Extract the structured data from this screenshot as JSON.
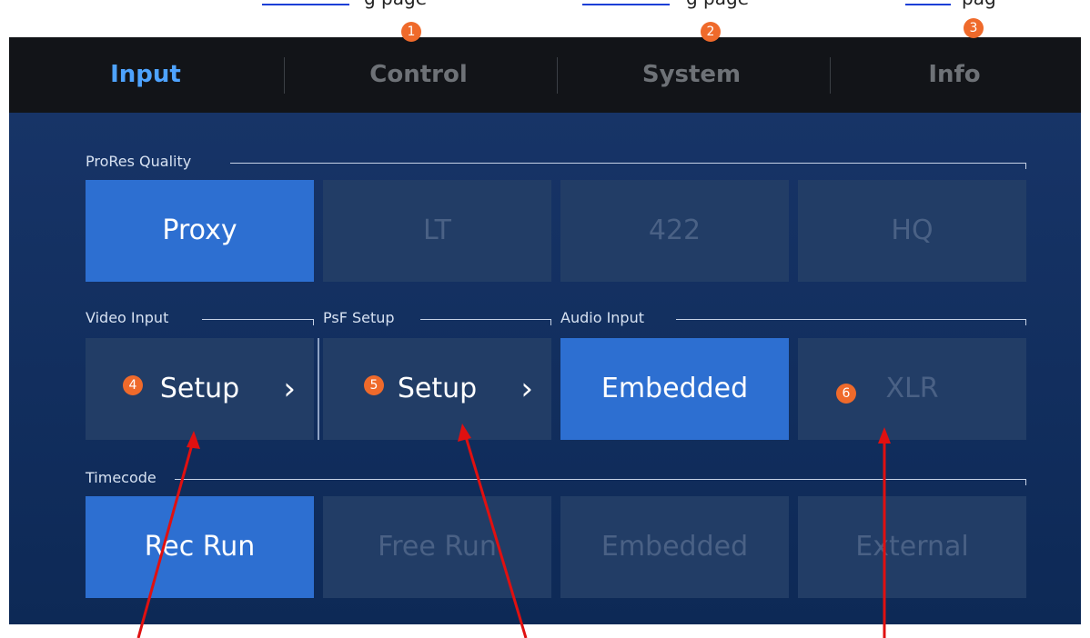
{
  "doc": {
    "link1": "",
    "link2": "",
    "link3": "",
    "text1": "g page",
    "text2": "g page",
    "text3": "pag"
  },
  "badges": [
    "1",
    "2",
    "3",
    "4",
    "5",
    "6"
  ],
  "tabs": [
    {
      "label": "Input",
      "active": true
    },
    {
      "label": "Control",
      "active": false
    },
    {
      "label": "System",
      "active": false
    },
    {
      "label": "Info",
      "active": false
    }
  ],
  "prores": {
    "label": "ProRes Quality",
    "options": [
      "Proxy",
      "LT",
      "422",
      "HQ"
    ],
    "selected": "Proxy"
  },
  "video_input": {
    "label": "Video Input",
    "button": "Setup",
    "chevron": "›"
  },
  "psf_setup": {
    "label": "PsF Setup",
    "button": "Setup",
    "chevron": "›"
  },
  "audio_input": {
    "label": "Audio Input",
    "options": [
      "Embedded",
      "XLR"
    ],
    "selected": "Embedded"
  },
  "timecode": {
    "label": "Timecode",
    "options": [
      "Rec Run",
      "Free Run",
      "Embedded",
      "External"
    ],
    "selected": "Rec Run"
  },
  "colors": {
    "accent": "#4ea3ff",
    "selected_tile": "#2d6fd1",
    "badge": "#ef6a2b",
    "arrow": "#e01010"
  }
}
